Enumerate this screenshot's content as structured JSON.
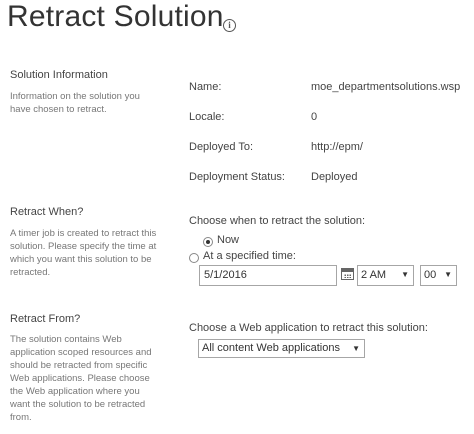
{
  "page": {
    "title": "Retract Solution",
    "info_icon": "info-icon"
  },
  "solution_info": {
    "title": "Solution Information",
    "description": "Information on the solution you have chosen to retract.",
    "fields": [
      {
        "label": "Name:",
        "value": "moe_departmentsolutions.wsp"
      },
      {
        "label": "Locale:",
        "value": "0"
      },
      {
        "label": "Deployed To:",
        "value": "http://epm/"
      },
      {
        "label": "Deployment Status:",
        "value": "Deployed"
      }
    ]
  },
  "retract_when": {
    "title": "Retract When?",
    "description": "A timer job is created to retract this solution. Please specify the time at which you want this solution to be retracted.",
    "prompt": "Choose when to retract the solution:",
    "option_now": "Now",
    "option_specified": "At a specified time:",
    "selected": "Now",
    "date_value": "5/1/2016",
    "calendar_icon": "calendar-icon",
    "hour_value": "2 AM",
    "minute_value": "00"
  },
  "retract_from": {
    "title": "Retract From?",
    "description": "The solution contains Web application scoped resources and should be retracted from specific Web applications. Please choose the Web application where you want the solution to be retracted from.",
    "prompt": "Choose a Web application to retract this solution:",
    "webapp_value": "All content Web applications"
  }
}
